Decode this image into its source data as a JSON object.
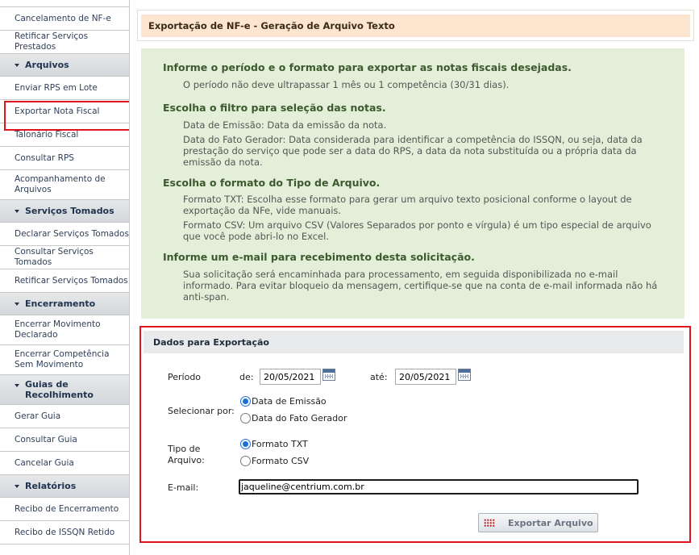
{
  "sidebar": {
    "items": [
      {
        "type": "item",
        "label": "Cancelamento de NF-e"
      },
      {
        "type": "item",
        "label": "Retificar Serviços Prestados"
      },
      {
        "type": "section",
        "label": "Arquivos"
      },
      {
        "type": "item",
        "label": "Enviar RPS em Lote"
      },
      {
        "type": "item",
        "label": "Exportar Nota Fiscal",
        "selected": true
      },
      {
        "type": "item",
        "label": "Talonário Fiscal"
      },
      {
        "type": "item",
        "label": "Consultar RPS"
      },
      {
        "type": "item",
        "label": "Acompanhamento de Arquivos"
      },
      {
        "type": "section",
        "label": "Serviços Tomados"
      },
      {
        "type": "item",
        "label": "Declarar Serviços Tomados"
      },
      {
        "type": "item",
        "label": "Consultar Serviços Tomados"
      },
      {
        "type": "item",
        "label": "Retificar Serviços Tomados"
      },
      {
        "type": "section",
        "label": "Encerramento"
      },
      {
        "type": "item",
        "label": "Encerrar Movimento Declarado"
      },
      {
        "type": "item",
        "label": "Encerrar Competência Sem Movimento"
      },
      {
        "type": "section",
        "label": "Guias de Recolhimento"
      },
      {
        "type": "item",
        "label": "Gerar Guia"
      },
      {
        "type": "item",
        "label": "Consultar Guia"
      },
      {
        "type": "item",
        "label": "Cancelar Guia"
      },
      {
        "type": "section",
        "label": "Relatórios"
      },
      {
        "type": "item",
        "label": "Recibo de Encerramento"
      },
      {
        "type": "item",
        "label": "Recibo de ISSQN Retido"
      }
    ]
  },
  "page": {
    "title": "Exportação de NF-e - Geração de Arquivo Texto"
  },
  "info": {
    "h1": "Informe o período e o formato para exportar as notas fiscais desejadas.",
    "p1": "O período não deve ultrapassar 1 mês ou 1 competência (30/31 dias).",
    "h2": "Escolha o filtro para seleção das notas.",
    "p2": "Data de Emissão: Data da emissão da nota.",
    "p3": "Data do Fato Gerador: Data considerada para identificar a competência do ISSQN, ou seja, data da prestação do serviço que pode ser a data do RPS, a data da nota substituída ou a própria data da emissão da nota.",
    "h3": "Escolha o formato do Tipo de Arquivo.",
    "p4": "Formato TXT: Escolha esse formato para gerar um arquivo texto posicional conforme o layout de exportação da NFe, vide manuais.",
    "p5": "Formato CSV: Um arquivo CSV (Valores Separados por ponto e vírgula) é um tipo especial de arquivo que você pode abri-lo no Excel.",
    "h4": "Informe um e-mail para recebimento desta solicitação.",
    "p6": "Sua solicitação será encaminhada para processamento, em seguida disponibilizada no e-mail informado. Para evitar bloqueio da mensagem, certifique-se que na conta de e-mail informada não há anti-span."
  },
  "form": {
    "header": "Dados para Exportação",
    "period_label": "Período",
    "from_label": "de:",
    "from_value": "20/05/2021",
    "to_label": "até:",
    "to_value": "20/05/2021",
    "select_label": "Selecionar por:",
    "filter_options": [
      "Data de Emissão",
      "Data do Fato Gerador"
    ],
    "filter_selected": "Data de Emissão",
    "type_label_1": "Tipo de",
    "type_label_2": "Arquivo:",
    "type_options": [
      "Formato TXT",
      "Formato CSV"
    ],
    "type_selected": "Formato TXT",
    "email_label": "E-mail:",
    "email_value": "jaqueline@centrium.com.br",
    "export_button": "Exportar Arquivo"
  },
  "colors": {
    "title_bg": "#fde5cf",
    "info_bg": "#e3efd9",
    "info_heading": "#3c5a2e",
    "highlight_red": "#e0141e",
    "radio_blue": "#1a6fd6"
  }
}
